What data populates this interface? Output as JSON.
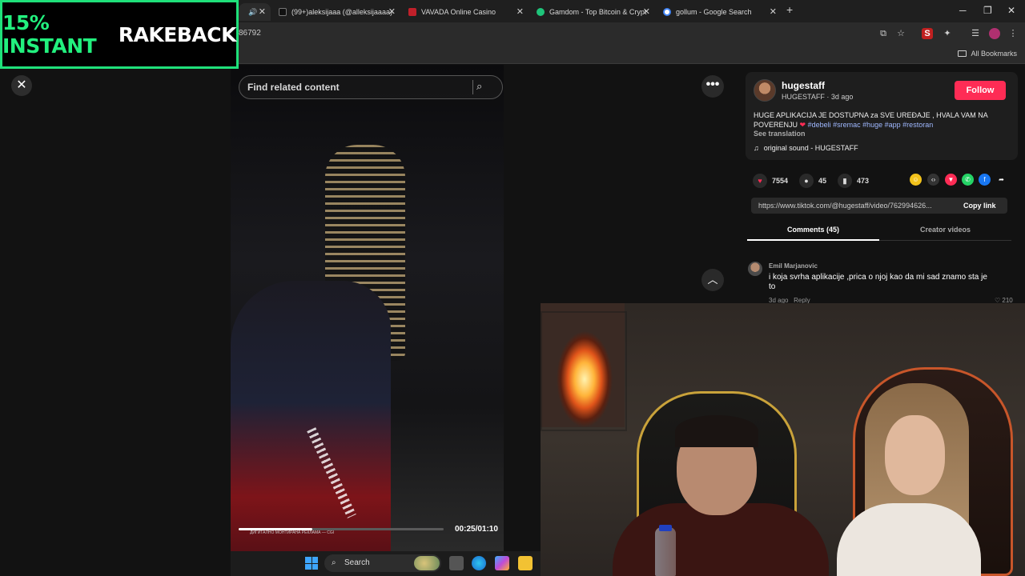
{
  "browser": {
    "tabs": [
      {
        "label": "(99+)aleksijaaa (@alleksijaaaa)",
        "favicon": "tiktok-icon",
        "active": true
      },
      {
        "label": "VAVADA Online Casino",
        "favicon": "vavada-icon",
        "active": false
      },
      {
        "label": "Gamdom - Top Bitcoin & Crypt",
        "favicon": "gamdom-icon",
        "active": false
      },
      {
        "label": "gollum - Google Search",
        "favicon": "google-icon",
        "active": false
      }
    ],
    "new_tab": "+",
    "address": "86792",
    "all_bookmarks": "All Bookmarks"
  },
  "overlay": {
    "promo_green": "15% INSTANT",
    "promo_white": "RAKEBACK",
    "accent_color": "#22f07e"
  },
  "video": {
    "search_placeholder": "Find related content",
    "time": "00:25/01:10",
    "progress_fraction": 0.36,
    "subtitle": "ДИГИТАЛНО МОНТИРАНА РЕКЛАМА — CGI"
  },
  "post": {
    "username": "hugestaff",
    "subline": "HUGESTAFF · 3d ago",
    "follow_label": "Follow",
    "follow_color": "#fe2c55",
    "description": "HUGE APLIKACIJA JE DOSTUPNA za SVE UREĐAJE , HVALA VAM NA POVERENJU",
    "hashtags": "#debeli #sremac #huge #app #restoran",
    "see_translation": "See translation",
    "sound": "original sound - HUGESTAFF",
    "likes": "7554",
    "comments": "45",
    "saves": "473",
    "link": "https://www.tiktok.com/@hugestaff/video/762994626...",
    "copy_link": "Copy link"
  },
  "tabs_panel": {
    "comments_tab": "Comments (45)",
    "creator_tab": "Creator videos"
  },
  "comment": {
    "author": "Emil Marjanovic",
    "text": "i koja svrha aplikacije ,prica o njoj kao da mi sad znamo sta je to",
    "age": "3d ago",
    "reply": "Reply",
    "likes": "210"
  },
  "taskbar": {
    "search_label": "Search"
  }
}
